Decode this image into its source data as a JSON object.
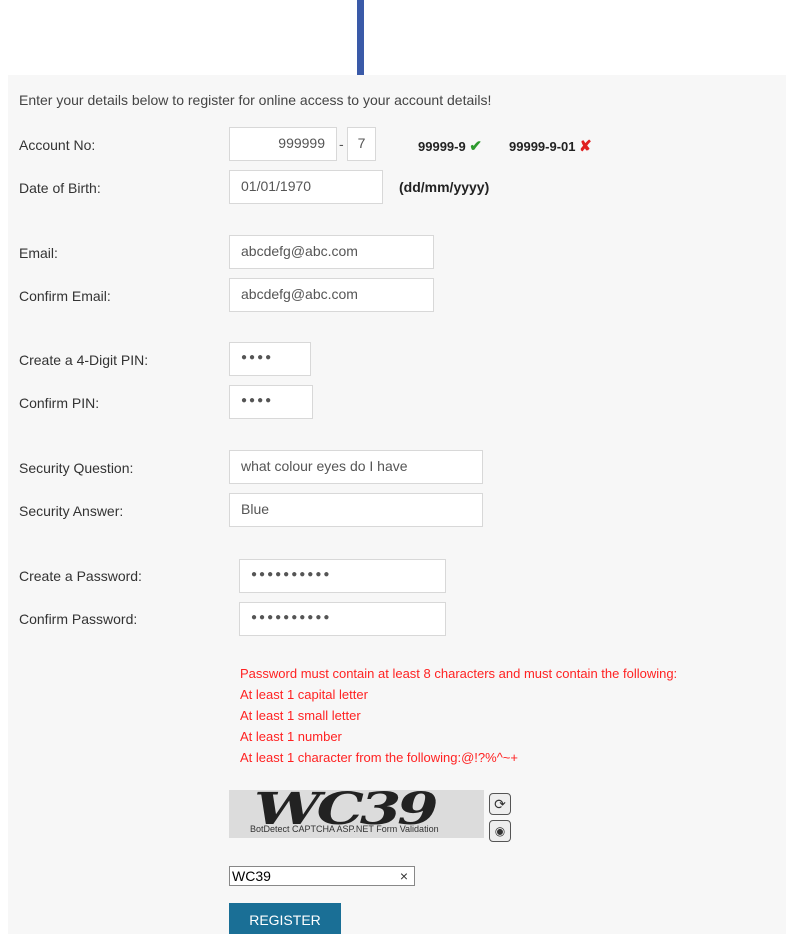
{
  "intro": "Enter your details below to register for online access to your account details!",
  "account": {
    "label": "Account No:",
    "number": "999999",
    "separator": "-",
    "suffix": "7",
    "example_ok": "99999-9",
    "example_bad": "99999-9-01",
    "ok_color": "#2e9a2e",
    "bad_color": "#e02020"
  },
  "dob": {
    "label": "Date of Birth:",
    "value": "01/01/1970",
    "hint": "(dd/mm/yyyy)"
  },
  "email": {
    "label": "Email:",
    "value": "abcdefg@abc.com"
  },
  "confirm_email": {
    "label": "Confirm Email:",
    "value": "abcdefg@abc.com"
  },
  "pin": {
    "label": "Create a 4-Digit PIN:",
    "value": "●●●●"
  },
  "confirm_pin": {
    "label": "Confirm PIN:",
    "value": "●●●●"
  },
  "security_question": {
    "label": "Security Question:",
    "value": "what colour eyes do I have"
  },
  "security_answer": {
    "label": "Security Answer:",
    "value": "Blue"
  },
  "password": {
    "label": "Create a Password:",
    "value": "●●●●●●●●●●"
  },
  "confirm_password": {
    "label": "Confirm Password:",
    "value": "●●●●●●●●●●"
  },
  "password_rules": [
    "Password must contain at least 8 characters and must contain the following:",
    "At least 1 capital letter",
    "At least 1 small letter",
    "At least 1 number",
    "At least 1 character from the following:@!?%^~+"
  ],
  "captcha": {
    "image_text": "WC39",
    "caption": "BotDetect CAPTCHA ASP.NET Form Validation",
    "input_value": "WC39",
    "clear_glyph": "×",
    "reload_icon": "reload-icon",
    "sound_icon": "sound-icon"
  },
  "register_label": "REGISTER",
  "annotation_color": "#3a5aa8"
}
